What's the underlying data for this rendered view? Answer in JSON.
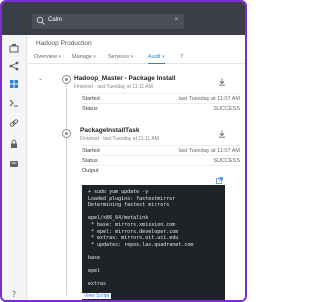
{
  "search": {
    "value": "Calm",
    "clear": "✕"
  },
  "breadcrumb": "Hadoop Production",
  "tabs": [
    {
      "label": "Overview",
      "chevron": "▾"
    },
    {
      "label": "Manage",
      "chevron": "▾"
    },
    {
      "label": "Services",
      "chevron": "▾"
    },
    {
      "label": "Audit",
      "chevron": "▾"
    },
    {
      "label": "?",
      "chevron": ""
    }
  ],
  "tasks": [
    {
      "title": "Hadoop_Master - Package Install",
      "subtitle": "Finished · last Tuesday at 11:11 AM",
      "rows": [
        {
          "key": "Started",
          "value": "last Tuesday at 11:07 AM"
        },
        {
          "key": "Status",
          "value": "SUCCESS"
        }
      ]
    },
    {
      "title": "PackageInstallTask",
      "subtitle": "Finished · last Tuesday at 11:11 AM",
      "rows": [
        {
          "key": "Started",
          "value": "last Tuesday at 11:07 AM"
        },
        {
          "key": "Status",
          "value": "SUCCESS"
        },
        {
          "key": "Output",
          "value": ""
        }
      ]
    }
  ],
  "console_lines": [
    "+ sudo yum update -y",
    "Loaded plugins: fastestmirror",
    "Determining fastest mirrors",
    "",
    "epel/x86_64/metalink",
    " * base: mirrors.xmission.com",
    " * epel: mirrors.developer.com",
    " * extras: mirrors.oit.uci.edu",
    " * updates: repos.lax.quadranet.com",
    "",
    "base",
    "",
    "epel",
    "",
    "extras"
  ],
  "view_script": "View Script",
  "colors": {
    "accent": "#2f7fd6",
    "frame": "#7d2bd6",
    "topbar": "#3a3f47",
    "console_bg": "#1f2328"
  },
  "icons": {
    "rail": [
      "dashboard-icon",
      "share-icon",
      "apps-icon",
      "terminal-icon",
      "link-icon",
      "lock-icon",
      "settings-icon",
      "help-icon"
    ]
  }
}
